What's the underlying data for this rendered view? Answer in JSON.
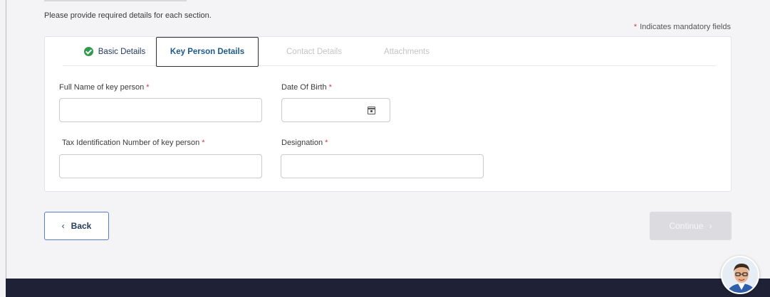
{
  "instruction": "Please provide required details for each section.",
  "mandatory_note": {
    "star": "*",
    "text": "Indicates mandatory fields"
  },
  "tabs": [
    {
      "label": "Basic Details",
      "state": "completed"
    },
    {
      "label": "Key Person Details",
      "state": "active"
    },
    {
      "label": "Contact Details",
      "state": "disabled"
    },
    {
      "label": "Attachments",
      "state": "disabled"
    }
  ],
  "form": {
    "full_name": {
      "label": "Full Name of key person",
      "required_mark": "*",
      "value": ""
    },
    "dob": {
      "label": "Date Of Birth",
      "required_mark": "*",
      "value": "",
      "icon": "calendar-icon"
    },
    "tin": {
      "label": "Tax Identification Number of key person",
      "required_mark": "*",
      "value": ""
    },
    "designation": {
      "label": "Designation",
      "required_mark": "*",
      "value": ""
    }
  },
  "buttons": {
    "back_chevron": "‹",
    "back_label": "Back",
    "continue_label": "Continue",
    "continue_chevron": "›"
  },
  "colors": {
    "completed_check": "#2e9a4e",
    "active_tab_text": "#1d5a8c",
    "required_star": "#d23c3c",
    "footer": "#1f2236",
    "continue_disabled": "#dcdce0"
  }
}
